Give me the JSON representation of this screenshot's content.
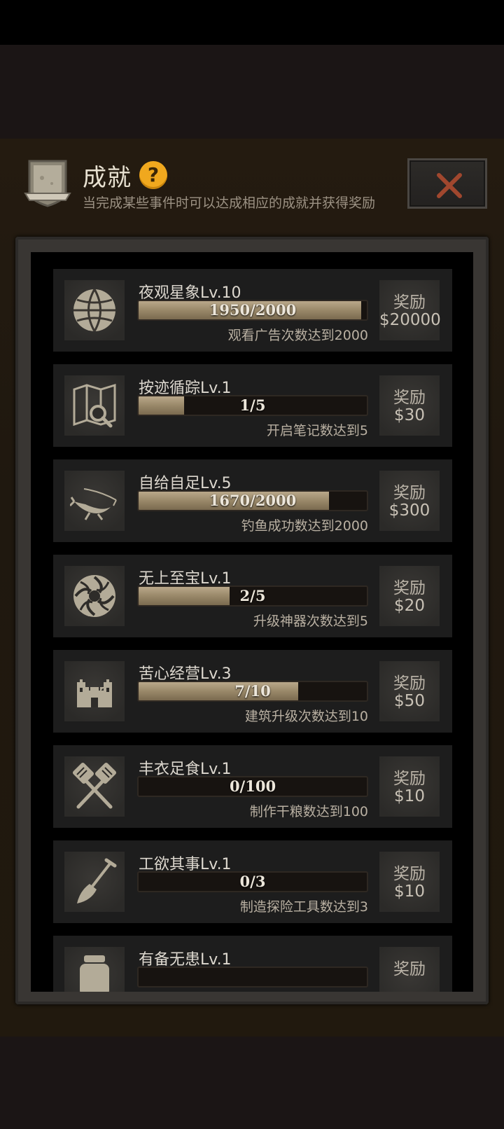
{
  "header": {
    "title": "成就",
    "help_symbol": "?",
    "subtitle": "当完成某些事件时可以达成相应的成就并获得奖励",
    "close_label": "×"
  },
  "colors": {
    "accent": "#f0a81e",
    "close_x": "#a0472e",
    "bar_fill": "#a39273"
  },
  "achievements": [
    {
      "name": "夜观星象Lv.10",
      "progress_text": "1950/2000",
      "progress": 0.975,
      "desc": "观看广告次数达到2000",
      "reward_label": "奖励",
      "reward_value": "$20000",
      "icon": "globe-icon"
    },
    {
      "name": "按迹循踪Lv.1",
      "progress_text": "1/5",
      "progress": 0.2,
      "desc": "开启笔记数达到5",
      "reward_label": "奖励",
      "reward_value": "$30",
      "icon": "map-search-icon"
    },
    {
      "name": "自给自足Lv.5",
      "progress_text": "1670/2000",
      "progress": 0.835,
      "desc": "钓鱼成功数达到2000",
      "reward_label": "奖励",
      "reward_value": "$300",
      "icon": "fishing-icon"
    },
    {
      "name": "无上至宝Lv.1",
      "progress_text": "2/5",
      "progress": 0.4,
      "desc": "升级神器次数达到5",
      "reward_label": "奖励",
      "reward_value": "$20",
      "icon": "ornament-icon"
    },
    {
      "name": "苦心经营Lv.3",
      "progress_text": "7/10",
      "progress": 0.7,
      "desc": "建筑升级次数达到10",
      "reward_label": "奖励",
      "reward_value": "$50",
      "icon": "castle-icon"
    },
    {
      "name": "丰衣足食Lv.1",
      "progress_text": "0/100",
      "progress": 0,
      "desc": "制作干粮数达到100",
      "reward_label": "奖励",
      "reward_value": "$10",
      "icon": "crossed-spatulas-icon"
    },
    {
      "name": "工欲其事Lv.1",
      "progress_text": "0/3",
      "progress": 0,
      "desc": "制造探险工具数达到3",
      "reward_label": "奖励",
      "reward_value": "$10",
      "icon": "shovel-icon"
    },
    {
      "name": "有备无患Lv.1",
      "progress_text": "",
      "progress": 0,
      "desc": "",
      "reward_label": "奖励",
      "reward_value": "",
      "icon": "jar-icon"
    }
  ]
}
